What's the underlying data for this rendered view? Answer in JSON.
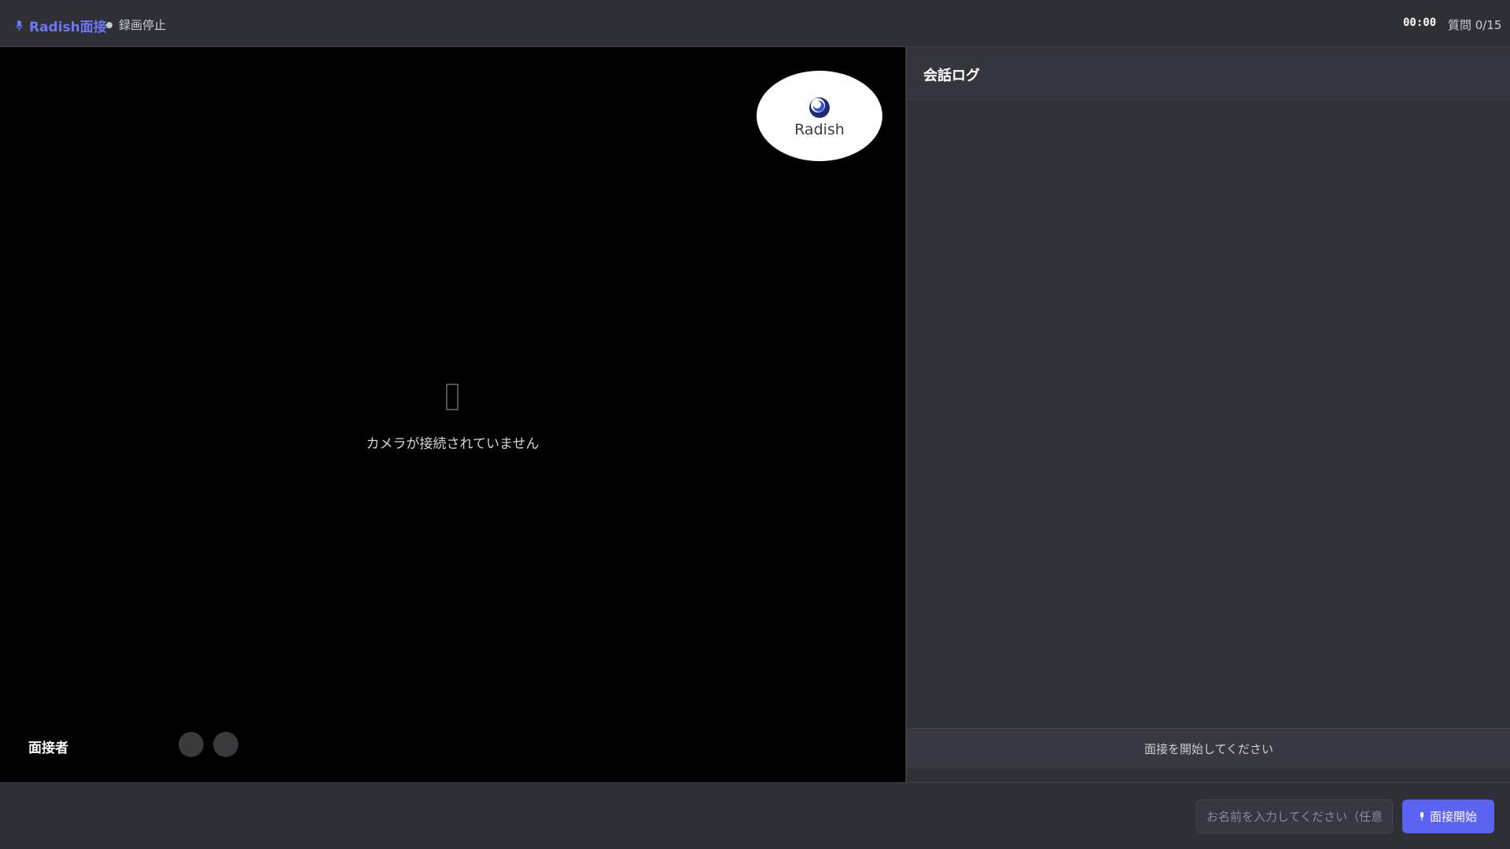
{
  "header": {
    "brand_icon": "mic-icon",
    "brand_name": "Radish面接",
    "recording_status": "録画停止",
    "timer": "00:00",
    "question_count": "質問 0/15"
  },
  "video": {
    "logo_text": "Radish",
    "camera_icon": "camera-off-icon",
    "camera_message": "カメラが接続されていません",
    "interviewer_label": "面接者"
  },
  "conversation": {
    "title": "会話ログ",
    "status_message": "面接を開始してください"
  },
  "footer": {
    "name_placeholder": "お名前を入力してください（任意）",
    "name_value": "",
    "start_label": "面接開始",
    "start_icon": "play-icon"
  },
  "colors": {
    "accent": "#5b63f0",
    "background": "#2d2f35",
    "video_background": "#000000"
  }
}
